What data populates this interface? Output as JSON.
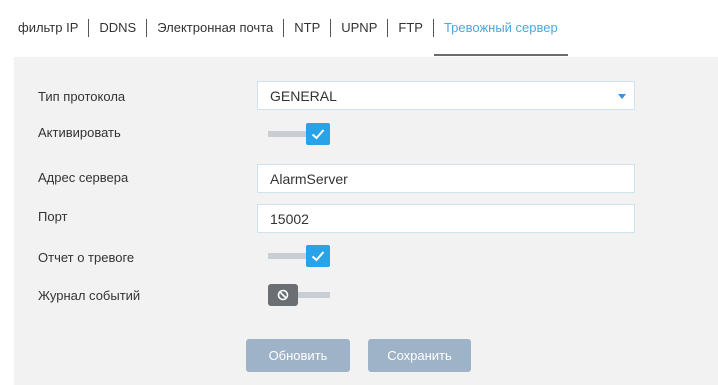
{
  "tabs": [
    {
      "label": "фильтр IP",
      "active": false
    },
    {
      "label": "DDNS",
      "active": false
    },
    {
      "label": "Электронная почта",
      "active": false
    },
    {
      "label": "NTP",
      "active": false
    },
    {
      "label": "UPNP",
      "active": false
    },
    {
      "label": "FTP",
      "active": false
    },
    {
      "label": "Тревожный сервер",
      "active": true
    }
  ],
  "form": {
    "protocol_type": {
      "label": "Тип протокола",
      "value": "GENERAL"
    },
    "activate": {
      "label": "Активировать",
      "enabled": true
    },
    "server_address": {
      "label": "Адрес сервера",
      "value": "AlarmServer"
    },
    "port": {
      "label": "Порт",
      "value": "15002"
    },
    "alarm_report": {
      "label": "Отчет о тревоге",
      "enabled": true
    },
    "event_log": {
      "label": "Журнал событий",
      "enabled": false
    }
  },
  "buttons": {
    "refresh": "Обновить",
    "save": "Сохранить"
  },
  "colors": {
    "accent": "#28a3e8",
    "active_tab": "#4aa8dd",
    "button": "#9fb3c8",
    "panel": "#f2f2f2"
  }
}
